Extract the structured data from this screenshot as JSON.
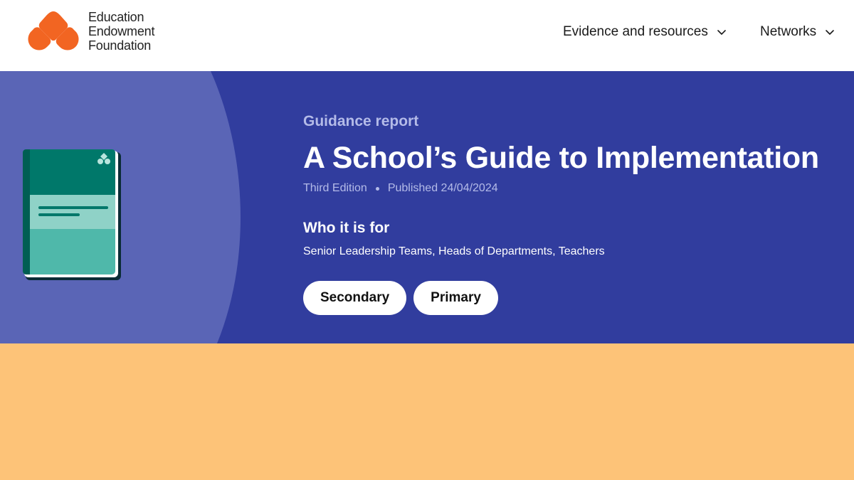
{
  "brand": {
    "name_lines": [
      "Education",
      "Endowment",
      "Foundation"
    ],
    "accent_color": "#f26522",
    "logo_icon": "eef-diamond-logo-icon"
  },
  "nav": {
    "items": [
      {
        "label": "Evidence and resources",
        "icon": "chevron-down-icon"
      },
      {
        "label": "Networks",
        "icon": "chevron-down-icon"
      }
    ]
  },
  "hero": {
    "background_color": "#313d9e",
    "circle_color": "#5a65b6",
    "eyebrow": "Guidance report",
    "title": "A School’s Guide to Implementation",
    "meta": {
      "edition": "Third Edition",
      "published": "Published 24/04/2024"
    },
    "audience": {
      "heading": "Who it is for",
      "list": "Senior Leadership Teams, Heads of Departments, Teachers"
    },
    "tags": [
      "Secondary",
      "Primary"
    ],
    "cover": {
      "icon": "report-cover-icon",
      "colors": {
        "top": "#00786a",
        "band": "#8fd2c7",
        "bottom": "#4fb8aa",
        "spine": "#005e53"
      }
    }
  },
  "lower_band": {
    "background_color": "#fdc378"
  }
}
